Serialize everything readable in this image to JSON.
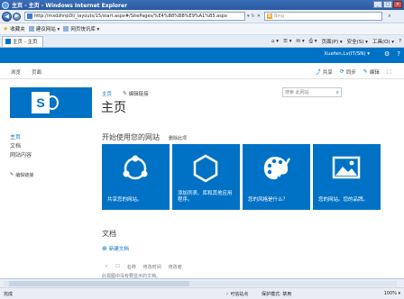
{
  "browser": {
    "window_title": "主页 - 主页 - Windows Internet Explorer",
    "address": "http://mxdzhnpDl/_layouts/15/start.aspx#/SitePages/%E4%B8%BB%E9%A1%B5.aspx",
    "search_placeholder": "Bing",
    "favorites_label": "收藏夹",
    "favorites": [
      "建议网站 ▾",
      "网页快讯库 ▾"
    ],
    "tab_title": "主页 - 主页",
    "commands": [
      "页面(P) ▾",
      "安全(S) ▾",
      "工具(O) ▾",
      "?"
    ],
    "status_done": "完成",
    "status_zone": "可信站点",
    "status_protected": "保护模式: 禁用",
    "status_zoom": "100% ▾"
  },
  "suite": {
    "user": "Xuefen.Lv(IT/SN) ▾",
    "icons": [
      "gear-icon",
      "help-icon"
    ]
  },
  "ribbon": {
    "tabs": [
      "浏览",
      "页面"
    ],
    "actions": [
      "共享",
      "同步",
      "编辑"
    ]
  },
  "site": {
    "breadcrumb_home": "主页",
    "edit_links": "编辑链接",
    "page_title": "主页",
    "search_placeholder": "搜索 此网站",
    "nav": [
      "主页",
      "文档",
      "网站内容"
    ],
    "nav_edit": "编辑链接"
  },
  "getting_started": {
    "title": "开始使用您的网站",
    "remove": "删除此项",
    "tiles": [
      {
        "caption": "共享您的网站。",
        "icon": "share-icon"
      },
      {
        "caption": "添加列表、库和其他应用程序。",
        "icon": "add-apps-icon"
      },
      {
        "caption": "您的风格是什么？",
        "icon": "palette-icon"
      },
      {
        "caption": "您的网站。您的品牌。",
        "icon": "picture-icon"
      }
    ]
  },
  "documents": {
    "title": "文档",
    "new_doc": "新建文档",
    "columns": [
      "✓",
      "☐",
      "名称",
      "修改时间",
      "修改者"
    ],
    "empty_note": "此视图中没有要显示的文档。"
  }
}
